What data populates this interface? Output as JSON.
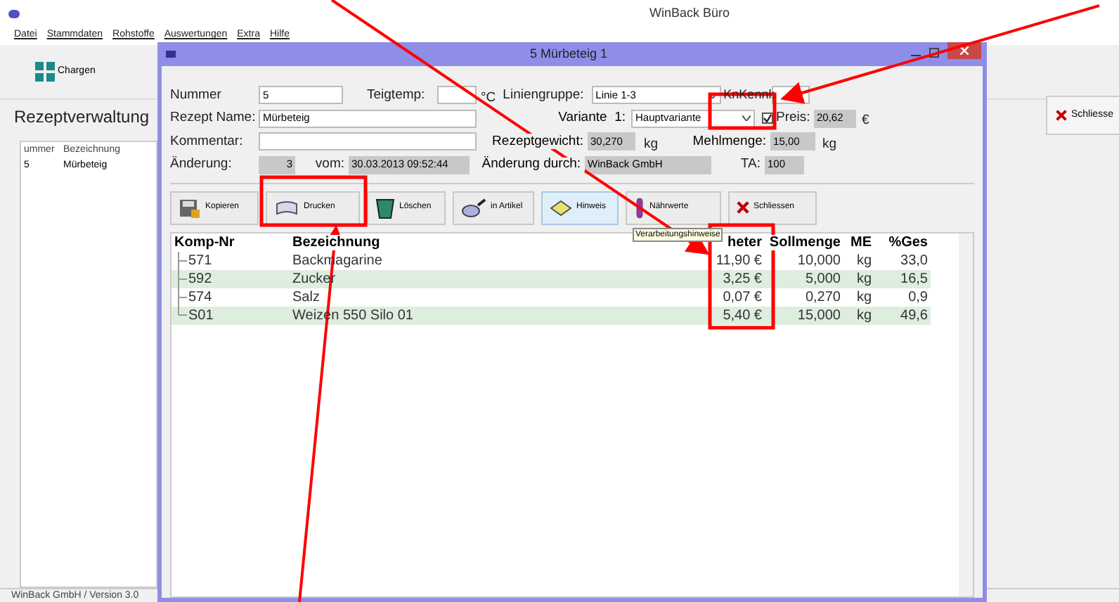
{
  "main_window": {
    "title": "WinBack Büro",
    "menu": [
      "Datei",
      "Stammdaten",
      "Rohstoffe",
      "Auswertungen",
      "Extra",
      "Hilfe"
    ],
    "toolbar": [
      {
        "label": "Chargen"
      }
    ],
    "heading": "Rezeptverwaltung",
    "list": {
      "columns": [
        "ummer",
        "Bezeichnung"
      ],
      "rows": [
        [
          "5",
          "Mürbeteig"
        ]
      ]
    },
    "close_button": "Schliesse",
    "status_bar": "WinBack GmbH / Version 3.0"
  },
  "dialog": {
    "title": "5 Mürbeteig 1",
    "form": {
      "nummer": {
        "label": "Nummer",
        "value": "5"
      },
      "teigtemp": {
        "label": "Teigtemp:",
        "unit": "°C"
      },
      "liniengruppe": {
        "label": "Liniengruppe:",
        "value": "Linie 1-3"
      },
      "knkennl": {
        "label": "KnKennl:"
      },
      "rezept_name": {
        "label": "Rezept Name:",
        "value": "Mürbeteig"
      },
      "variante": {
        "label": "Variante",
        "number": "1:",
        "value": "Hauptvariante"
      },
      "preis": {
        "label": "Preis:",
        "checked": true,
        "value": "20,62",
        "unit": "€"
      },
      "kommentar": {
        "label": "Kommentar:"
      },
      "rezeptgewicht": {
        "label": "Rezeptgewicht:",
        "value": "30,270",
        "unit": "kg"
      },
      "mehlmenge": {
        "label": "Mehlmenge:",
        "value": "15,00",
        "unit": "kg"
      },
      "aenderung": {
        "label": "Änderung:",
        "value": "3"
      },
      "vom": {
        "label": "vom:",
        "value": "30.03.2013 09:52:44"
      },
      "aenderung_durch": {
        "label": "Änderung durch:",
        "value": "WinBack GmbH"
      },
      "ta": {
        "label": "TA:",
        "value": "100"
      }
    },
    "buttons": [
      {
        "label": "Kopieren",
        "highlighted": false
      },
      {
        "label": "Drucken",
        "highlighted": false
      },
      {
        "label": "Löschen",
        "highlighted": false
      },
      {
        "label": "in Artikel",
        "highlighted": false
      },
      {
        "label": "Hinweis",
        "highlighted": true
      },
      {
        "label": "Nährwerte",
        "highlighted": false
      },
      {
        "label": "Schliessen",
        "highlighted": false
      }
    ],
    "tooltip": "Verarbeitungshinweise",
    "table": {
      "columns": [
        "Komp-Nr",
        "Bezeichnung",
        "heter",
        "Sollmenge",
        "ME",
        "%Ges"
      ],
      "rows": [
        [
          "571",
          "Backmagarine",
          "11,90 €",
          "10,000",
          "kg",
          "33,0"
        ],
        [
          "592",
          "Zucker",
          "3,25 €",
          "5,000",
          "kg",
          "16,5"
        ],
        [
          "574",
          "Salz",
          "0,07 €",
          "0,270",
          "kg",
          "0,9"
        ],
        [
          "S01",
          "Weizen 550 Silo 01",
          "5,40 €",
          "15,000",
          "kg",
          "49,6"
        ]
      ]
    }
  }
}
